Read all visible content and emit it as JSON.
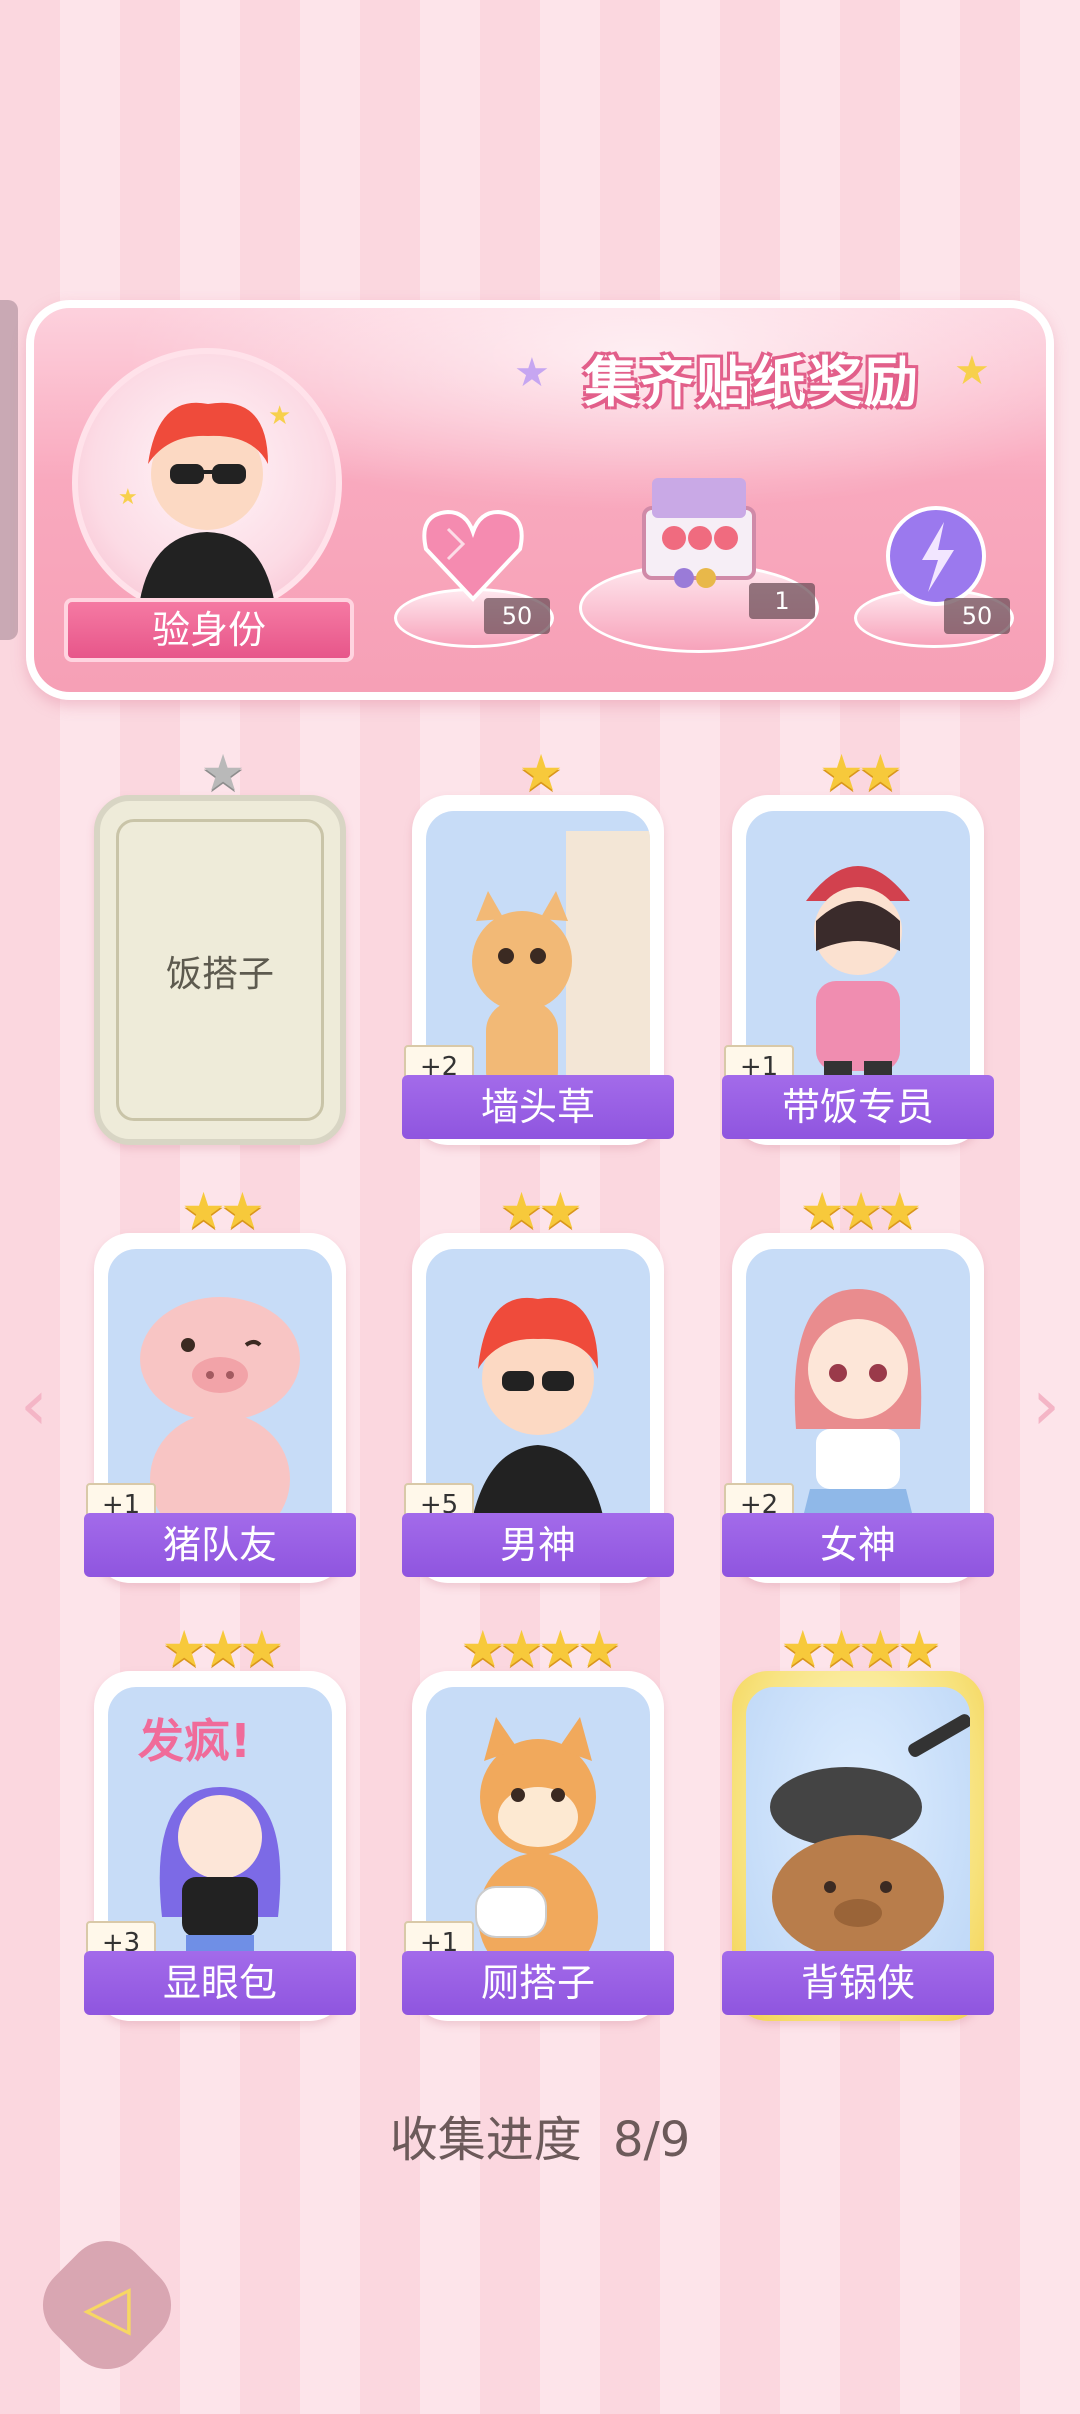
{
  "banner": {
    "title": "集齐贴纸奖励",
    "id_button": "验身份",
    "rewards": [
      {
        "icon": "pink-heart-gem-icon",
        "count": "50"
      },
      {
        "icon": "gift-box-icon",
        "count": "1"
      },
      {
        "icon": "purple-energy-orb-icon",
        "count": "50"
      }
    ]
  },
  "cards": [
    {
      "name": "饭搭子",
      "stars": 1,
      "locked": true,
      "bonus": ""
    },
    {
      "name": "墙头草",
      "stars": 1,
      "locked": false,
      "bonus": "+2"
    },
    {
      "name": "带饭专员",
      "stars": 2,
      "locked": false,
      "bonus": "+1"
    },
    {
      "name": "猪队友",
      "stars": 2,
      "locked": false,
      "bonus": "+1"
    },
    {
      "name": "男神",
      "stars": 2,
      "locked": false,
      "bonus": "+5"
    },
    {
      "name": "女神",
      "stars": 3,
      "locked": false,
      "bonus": "+2"
    },
    {
      "name": "显眼包",
      "stars": 3,
      "locked": false,
      "bonus": "+3"
    },
    {
      "name": "厕搭子",
      "stars": 4,
      "locked": false,
      "bonus": "+1"
    },
    {
      "name": "背锅侠",
      "stars": 4,
      "locked": false,
      "bonus": ""
    }
  ],
  "card_text": {
    "c2_stars": "★",
    "c3_stars": "★★",
    "c4_stars": "★★",
    "c5_stars": "★★",
    "c6_stars": "★★★",
    "c7_stars": "★★★",
    "c8_stars": "★★★★",
    "c9_stars": "★★★★",
    "c1_stars": "★"
  },
  "progress": {
    "label": "收集进度",
    "value": "8/9",
    "collected": 8,
    "total": 9
  },
  "nav": {
    "left": "‹",
    "right": "›"
  },
  "back": "◁",
  "colors": {
    "accent_purple": "#9b62e6",
    "pink_bg": "#fbd7df",
    "star_gold": "#f7c93b"
  }
}
